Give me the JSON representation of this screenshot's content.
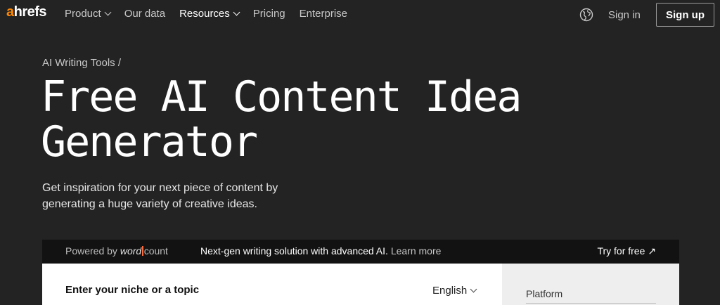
{
  "nav": {
    "logo_prefix": "a",
    "logo_rest": "hrefs",
    "links": [
      {
        "label": "Product",
        "dropdown": true
      },
      {
        "label": "Our data",
        "dropdown": false
      },
      {
        "label": "Resources",
        "dropdown": true
      },
      {
        "label": "Pricing",
        "dropdown": false
      },
      {
        "label": "Enterprise",
        "dropdown": false
      }
    ],
    "globe_icon": "globe-icon",
    "signin_label": "Sign in",
    "signup_label": "Sign up"
  },
  "hero": {
    "breadcrumb": "AI Writing Tools /",
    "title_line1": "Free AI Content Idea",
    "title_line2": "Generator",
    "subtitle": "Get inspiration for your next piece of content by generating a huge variety of creative ideas."
  },
  "promo": {
    "powered_prefix": "Powered by ",
    "brand_word": "word",
    "brand_count": "count",
    "text": "Next-gen writing solution with advanced AI.",
    "learn_more": "Learn more",
    "try_label": "Try for free ↗"
  },
  "form": {
    "niche_label": "Enter your niche or a topic",
    "language": "English",
    "platform_label": "Platform"
  },
  "colors": {
    "background": "#232323",
    "logo_accent": "#ff8800",
    "promo_bar": "#121212"
  }
}
